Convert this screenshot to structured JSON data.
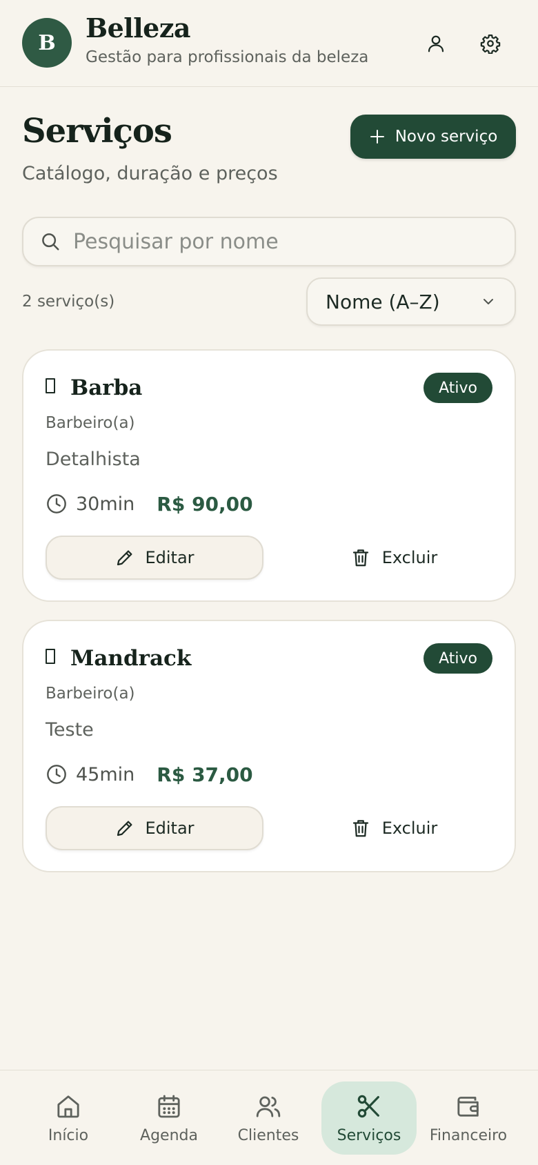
{
  "header": {
    "avatar_letter": "B",
    "title": "Belleza",
    "subtitle": "Gestão para profissionais da beleza",
    "icons": [
      "user-icon",
      "settings-icon"
    ]
  },
  "page": {
    "title": "Serviços",
    "subtitle": "Catálogo, duração e preços",
    "new_button_label": "Novo serviço"
  },
  "search": {
    "placeholder": "Pesquisar por nome",
    "value": ""
  },
  "list": {
    "count_label": "2 serviço(s)",
    "sort_selected": "Nome (A–Z)"
  },
  "services": [
    {
      "name": "Barba",
      "status": "Ativo",
      "category": "Barbeiro(a)",
      "description": "Detalhista",
      "duration": "30min",
      "price": "R$ 90,00",
      "edit_label": "Editar",
      "delete_label": "Excluir"
    },
    {
      "name": "Mandrack",
      "status": "Ativo",
      "category": "Barbeiro(a)",
      "description": "Teste",
      "duration": "45min",
      "price": "R$ 37,00",
      "edit_label": "Editar",
      "delete_label": "Excluir"
    }
  ],
  "nav": {
    "active": "Serviços",
    "items": [
      {
        "label": "Início",
        "icon": "home-icon"
      },
      {
        "label": "Agenda",
        "icon": "calendar-icon"
      },
      {
        "label": "Clientes",
        "icon": "users-icon"
      },
      {
        "label": "Serviços",
        "icon": "scissors-icon"
      },
      {
        "label": "Financeiro",
        "icon": "wallet-icon"
      }
    ]
  },
  "colors": {
    "background": "#f7f4ed",
    "primary": "#224a36",
    "price": "#2b5a42",
    "active_nav": "#d6e8dc"
  }
}
